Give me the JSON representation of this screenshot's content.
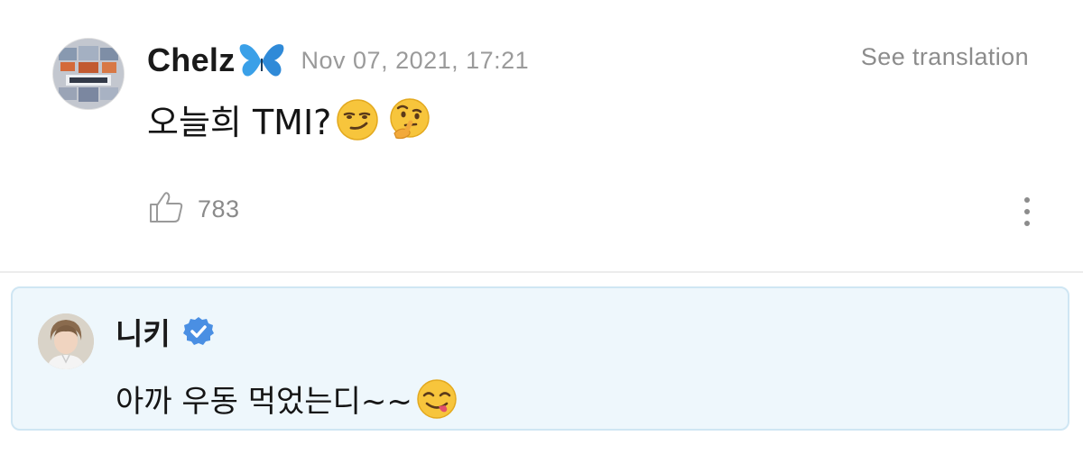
{
  "post": {
    "author": "Chelz",
    "author_emoji_icon": "butterfly-icon",
    "timestamp": "Nov 07, 2021, 17:21",
    "see_translation": "See translation",
    "text": "오늘희 TMI?",
    "text_emoji_icons": [
      "smirking-face-icon",
      "thinking-face-icon"
    ],
    "like_count": "783"
  },
  "reply": {
    "author": "니키",
    "verified": true,
    "text": "아까 우동 먹었는디~~",
    "text_emoji_icon": "face-savoring-food-icon"
  },
  "colors": {
    "reply_background": "#eef7fc",
    "reply_border": "#cfe6f3",
    "verified_badge": "#4a8fe3",
    "muted_text": "#9a9a9a"
  }
}
